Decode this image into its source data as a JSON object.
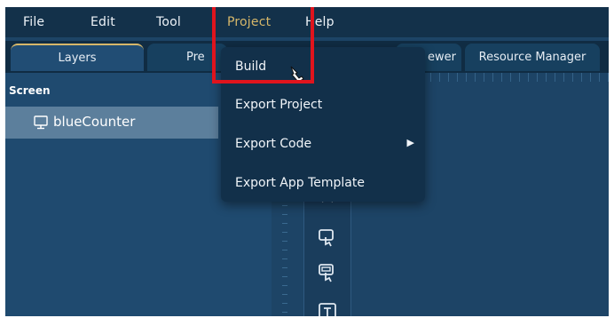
{
  "menubar": {
    "items": [
      "File",
      "Edit",
      "Tool",
      "Project",
      "Help"
    ],
    "active": "Project"
  },
  "tabs": {
    "layers": "Layers",
    "preview": "Pre",
    "viewer": "ewer",
    "resource": "Resource Manager"
  },
  "panel": {
    "header": "Screen",
    "layers": [
      {
        "label": "blueCounter",
        "icon": "monitor-icon"
      }
    ]
  },
  "dropdown": {
    "items": [
      {
        "label": "Build"
      },
      {
        "label": "Export Project"
      },
      {
        "label": "Export Code",
        "has_submenu": true
      },
      {
        "label": "Export App Template"
      }
    ]
  },
  "colors": {
    "menubar_bg": "#13314a",
    "panel_bg": "#1f4a6f",
    "active_menu": "#d6b76a",
    "highlight": "#e0141d"
  }
}
